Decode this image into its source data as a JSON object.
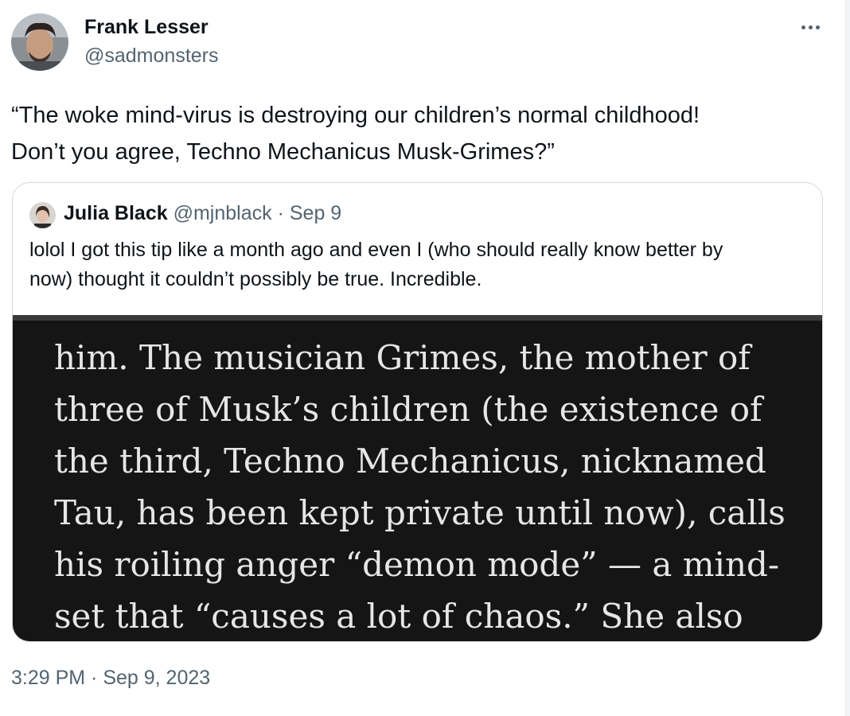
{
  "tweet": {
    "author": {
      "name": "Frank Lesser",
      "handle": "@sadmonsters"
    },
    "more_icon": "more-horizontal-icon",
    "text_lines": [
      "“The woke mind-virus is destroying our children’s normal childhood!",
      "Don’t you agree, Techno Mechanicus Musk-Grimes?”"
    ],
    "timestamp": "3:29 PM · Sep 9, 2023"
  },
  "quote": {
    "author": {
      "name": "Julia Black",
      "handle": "@mjnblack",
      "separator": "·",
      "date": "Sep 9"
    },
    "text_lines": [
      "lolol I got this tip like a month ago and even I (who should really know better by",
      "now) thought it couldn’t possibly be true. Incredible."
    ],
    "media_text_lines": [
      "him. The musician Grimes, the mother of",
      "three of Musk’s children (the existence of",
      "the third, Techno Mechanicus, nicknamed",
      "Tau, has been kept private until now), calls",
      "his roiling anger “demon mode” — a mind-",
      "set that “causes a lot of chaos.” She also"
    ]
  },
  "colors": {
    "primary_text": "#0f1419",
    "secondary_text": "#536471",
    "border": "#cfd9de",
    "media_background": "#151515",
    "media_text": "#e6e6e6"
  }
}
